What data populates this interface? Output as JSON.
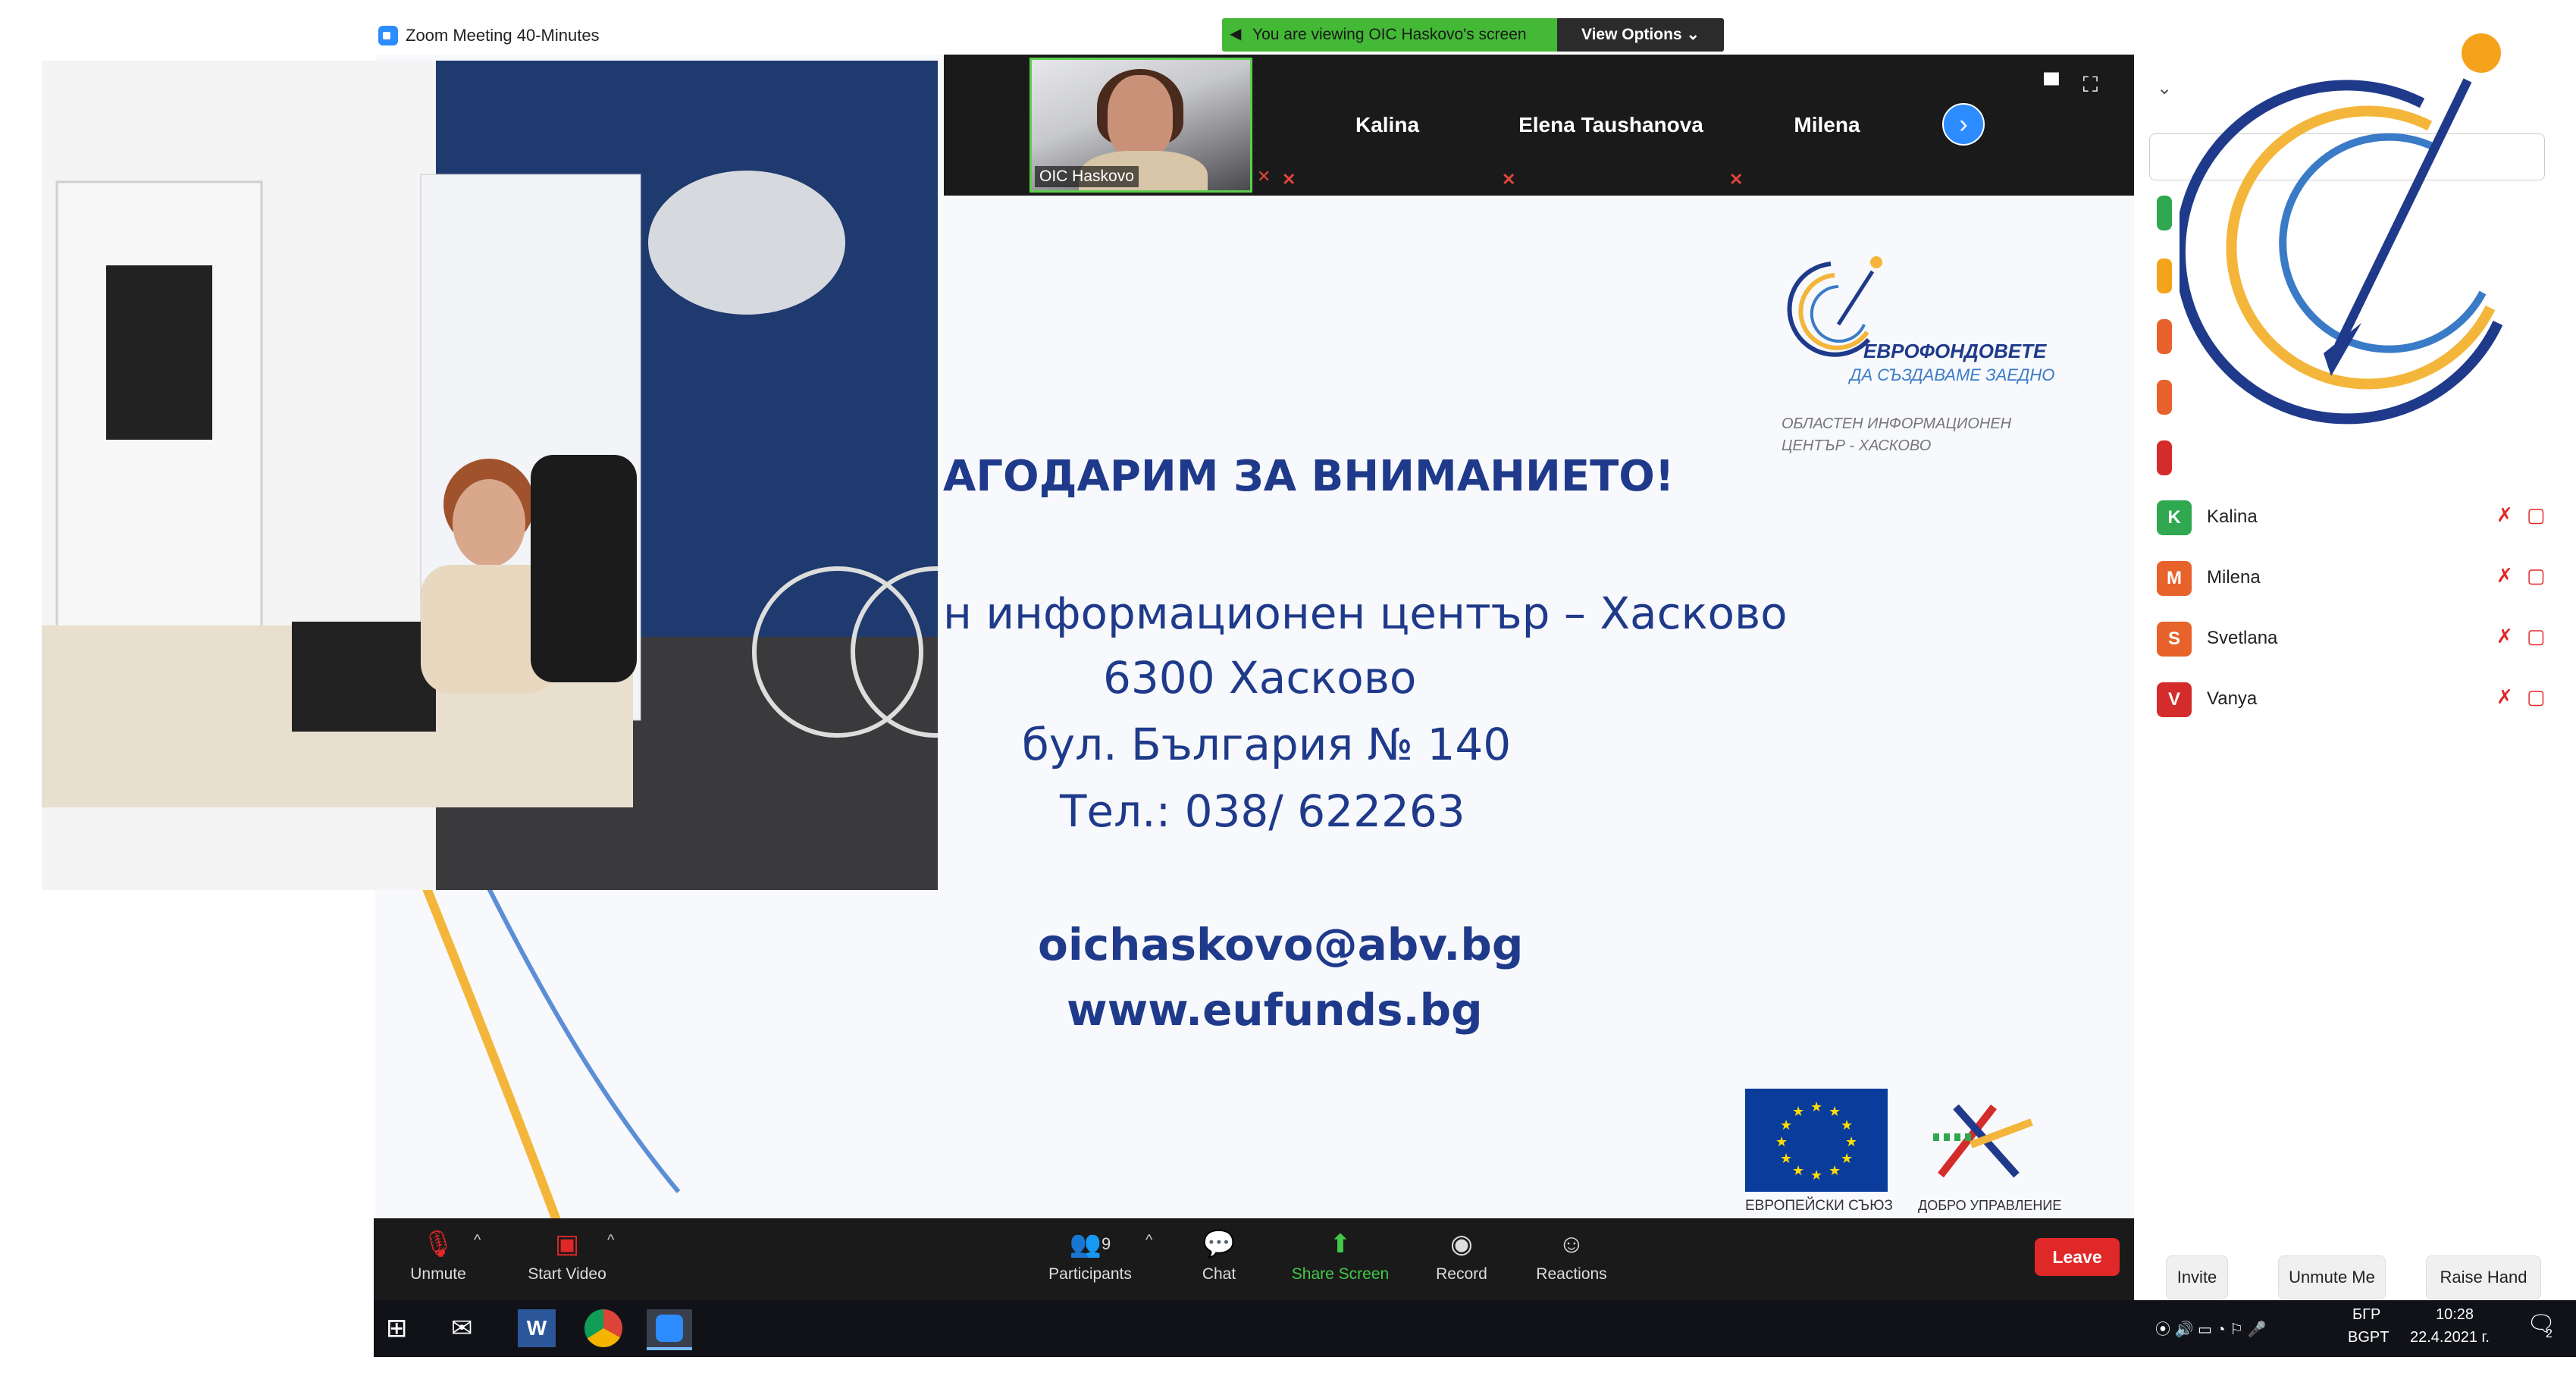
{
  "window": {
    "title": "Zoom Meeting 40-Minutes"
  },
  "banner": {
    "viewing": "You are viewing OIC Haskovo's screen",
    "view_options": "View Options"
  },
  "video_strip": {
    "self_label": "OIC Haskovo",
    "participants": [
      "Kalina",
      "Elena Taushanova",
      "Milena"
    ]
  },
  "slide": {
    "title": "АГОДАРИМ ЗА ВНИМАНИЕТО!",
    "logo_line1": "ЕВРОФОНДОВЕТЕ",
    "logo_line2": "ДА СЪЗДАВАМЕ ЗАЕДНО",
    "logo_line3": "ОБЛАСТЕН ИНФОРМАЦИОНЕН",
    "logo_line4": "ЦЕНТЪР - ХАСКОВО",
    "address_line1": "н информационен център – Хасково",
    "address_line2": "6300 Хасково",
    "address_line3": "бул. България № 140",
    "address_line4": "Тел.: 038/ 622263",
    "email": "oichaskovo@abv.bg",
    "website": "www.eufunds.bg",
    "eu_label": "ЕВРОПЕЙСКИ СЪЮЗ",
    "dobro_label": "ДОБРО УПРАВЛЕНИЕ"
  },
  "toolbar": {
    "unmute": "Unmute",
    "start_video": "Start Video",
    "participants": "Participants",
    "participants_count": "9",
    "chat": "Chat",
    "share_screen": "Share Screen",
    "record": "Record",
    "reactions": "Reactions",
    "leave": "Leave"
  },
  "panel": {
    "participants": [
      {
        "initial": "K",
        "name": "Kalina",
        "color": "#2fa84f"
      },
      {
        "initial": "M",
        "name": "Milena",
        "color": "#e8622c"
      },
      {
        "initial": "S",
        "name": "Svetlana",
        "color": "#e8622c"
      },
      {
        "initial": "V",
        "name": "Vanya",
        "color": "#d42b2b"
      }
    ],
    "partial_avatar_colors": [
      "#2fa84f",
      "#f4a31a",
      "#e8622c",
      "#e8622c",
      "#d42b2b"
    ],
    "invite": "Invite",
    "unmute_me": "Unmute Me",
    "raise_hand": "Raise Hand"
  },
  "taskbar": {
    "language": "БГР",
    "layout": "BGPT",
    "time": "10:28",
    "date": "22.4.2021 г.",
    "notification_count": "2"
  },
  "colors": {
    "zoom_blue": "#2d8cff",
    "share_green": "#43b936",
    "leave_red": "#e02828",
    "slide_blue": "#1f3a8a"
  }
}
